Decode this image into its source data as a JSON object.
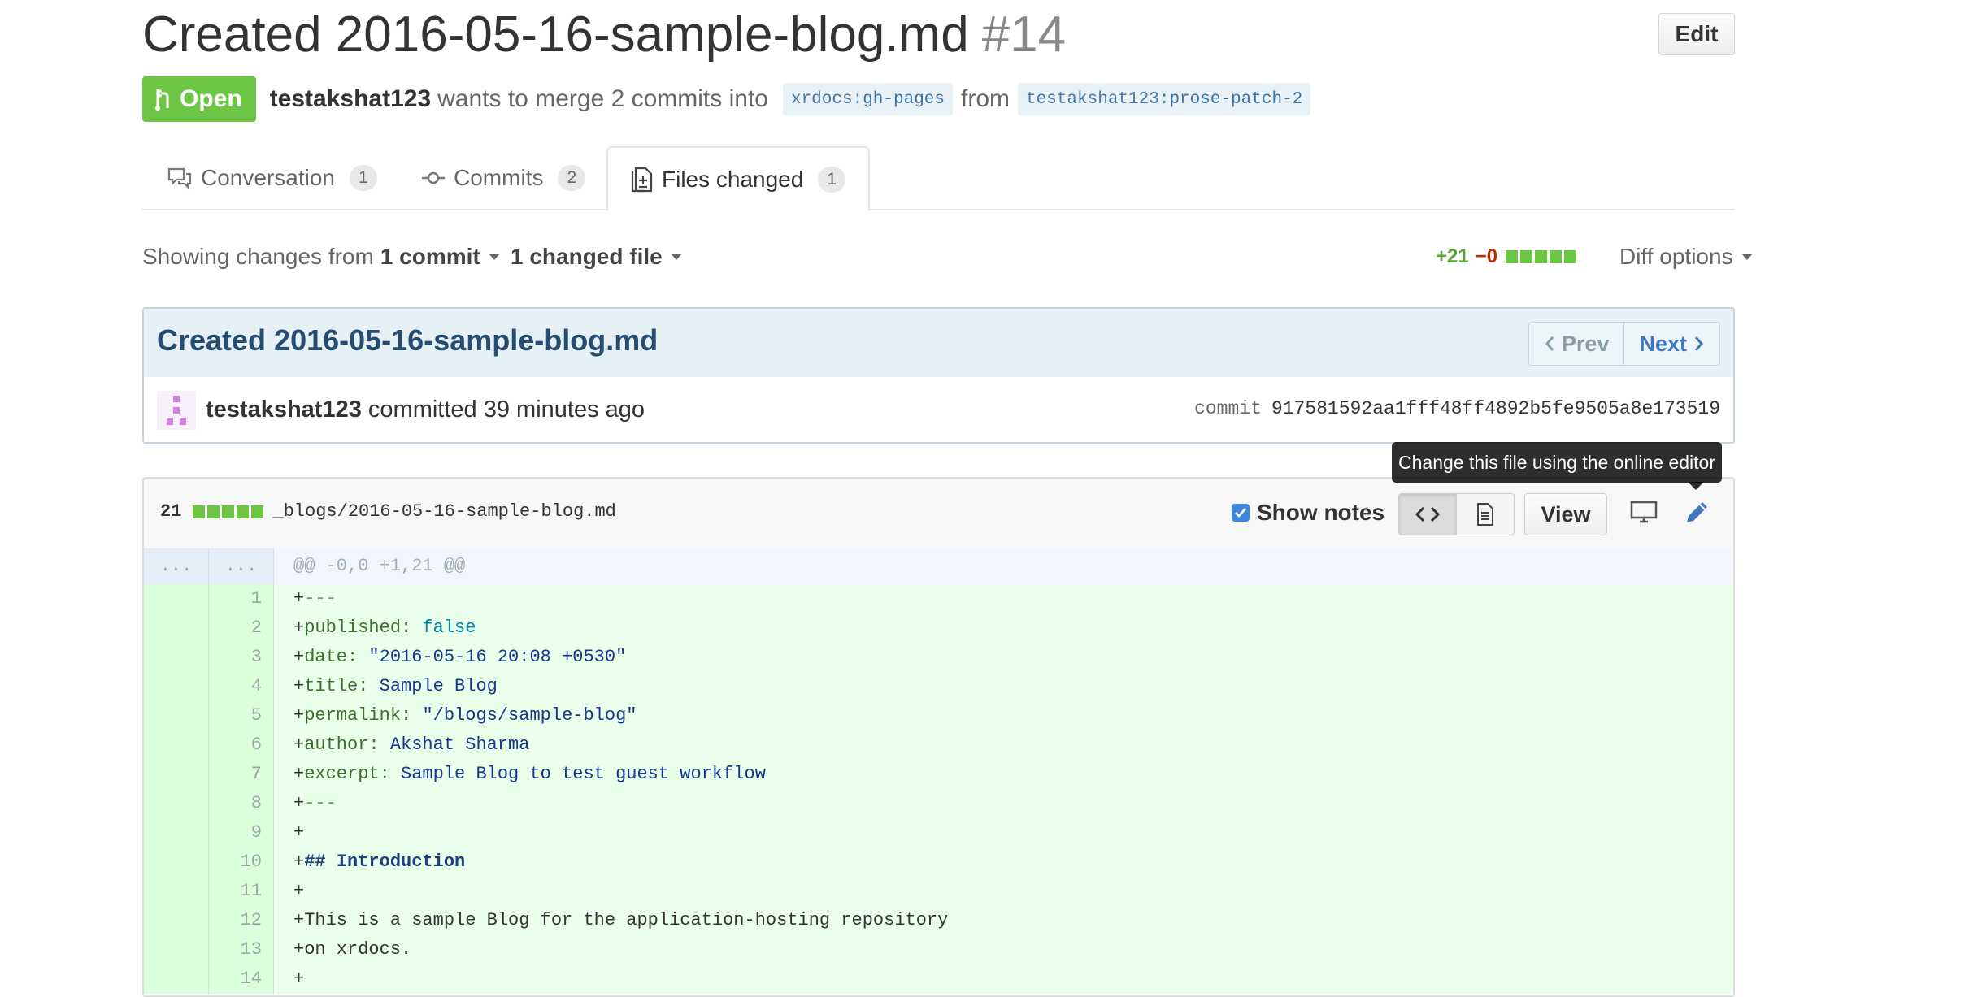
{
  "pull_request": {
    "title": "Created 2016-05-16-sample-blog.md",
    "number": "#14",
    "edit_label": "Edit",
    "state": "Open",
    "author": "testakshat123",
    "merge_text": "wants to merge 2 commits into",
    "base_owner": "xrdocs",
    "base_branch": ":gh-pages",
    "from_text": "from",
    "head_owner": "testakshat123",
    "head_branch": ":prose-patch-2"
  },
  "tabs": [
    {
      "label": "Conversation",
      "count": "1"
    },
    {
      "label": "Commits",
      "count": "2"
    },
    {
      "label": "Files changed",
      "count": "1"
    }
  ],
  "toolbar": {
    "showing_prefix": "Showing changes from",
    "commit_count": "1 commit",
    "changed_files": "1 changed file",
    "additions": "+21",
    "deletions": "−0",
    "diff_options": "Diff options"
  },
  "commit": {
    "title": "Created 2016-05-16-sample-blog.md",
    "prev_label": "Prev",
    "next_label": "Next",
    "author": "testakshat123",
    "committed_text": "committed 39 minutes ago",
    "sha_label": "commit",
    "sha": "917581592aa1fff48ff4892b5fe9505a8e173519"
  },
  "tooltip": "Change this file using the online editor",
  "file": {
    "changes": "21",
    "path": "_blogs/2016-05-16-sample-blog.md",
    "show_notes_label": "Show notes",
    "view_label": "View"
  },
  "diff": {
    "hunk_header": "@@ -0,0 +1,21 @@",
    "hunk_ellipsis": "...",
    "lines": [
      {
        "n": "1",
        "plus": "+",
        "key": "",
        "value": "---",
        "kind": "dash"
      },
      {
        "n": "2",
        "plus": "+",
        "key": "published:",
        "value": "false",
        "kind": "bool"
      },
      {
        "n": "3",
        "plus": "+",
        "key": "date:",
        "value": "\"2016-05-16 20:08 +0530\"",
        "kind": "str"
      },
      {
        "n": "4",
        "plus": "+",
        "key": "title:",
        "value": "Sample Blog",
        "kind": "str"
      },
      {
        "n": "5",
        "plus": "+",
        "key": "permalink:",
        "value": "\"/blogs/sample-blog\"",
        "kind": "str"
      },
      {
        "n": "6",
        "plus": "+",
        "key": "author:",
        "value": "Akshat Sharma",
        "kind": "str"
      },
      {
        "n": "7",
        "plus": "+",
        "key": "excerpt:",
        "value": "Sample Blog to test guest workflow",
        "kind": "str"
      },
      {
        "n": "8",
        "plus": "+",
        "key": "",
        "value": "---",
        "kind": "dash"
      },
      {
        "n": "9",
        "plus": "+",
        "key": "",
        "value": "",
        "kind": "plain"
      },
      {
        "n": "10",
        "plus": "+",
        "key": "",
        "value": "## Introduction",
        "kind": "heading"
      },
      {
        "n": "11",
        "plus": "+",
        "key": "",
        "value": "",
        "kind": "plain"
      },
      {
        "n": "12",
        "plus": "+",
        "key": "",
        "value": "This is a sample Blog for the application-hosting repository",
        "kind": "plain"
      },
      {
        "n": "13",
        "plus": "+",
        "key": "",
        "value": "on xrdocs.",
        "kind": "plain"
      },
      {
        "n": "14",
        "plus": "+",
        "key": "",
        "value": "",
        "kind": "plain"
      }
    ]
  },
  "colors": {
    "open_badge": "#6cc644",
    "link": "#4078c0",
    "addition_bg": "#eaffea",
    "tooltip_bg": "#1b1f23"
  },
  "icons": [
    "git-pull-request-icon",
    "comment-discussion-icon",
    "git-commit-icon",
    "diff-icon",
    "chevron-left-icon",
    "chevron-right-icon",
    "code-icon",
    "file-text-icon",
    "device-desktop-icon",
    "pencil-icon",
    "checkbox-check-icon"
  ]
}
